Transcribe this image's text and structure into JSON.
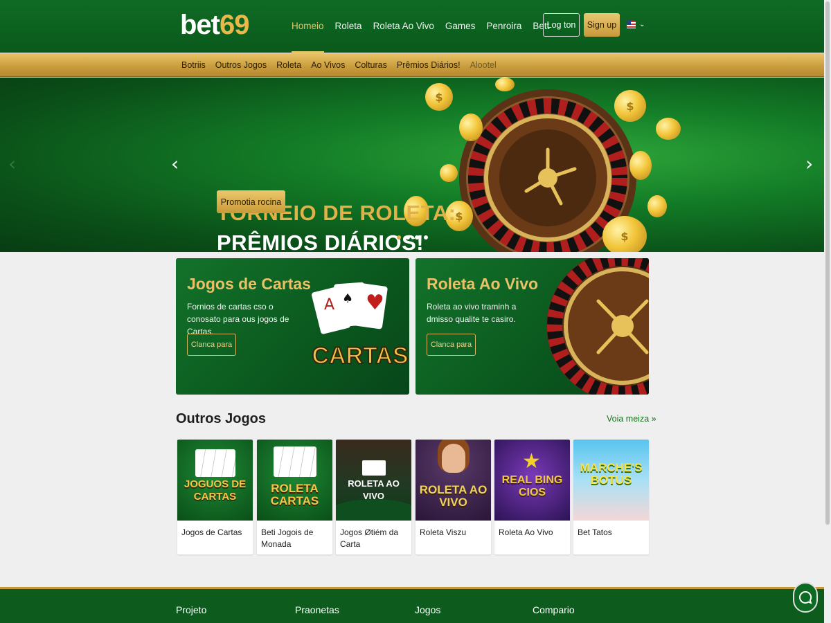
{
  "header": {
    "logo_text": "bet",
    "logo_number": "69",
    "nav": [
      "Homeio",
      "Roleta",
      "Roleta Ao Vivo",
      "Games",
      "Penroira",
      "Bett"
    ],
    "login_label": "Log ton",
    "signup_label": "Sign up",
    "language_icon": "us-flag-icon"
  },
  "subnav": [
    "Botriis",
    "Outros Jogos",
    "Roleta",
    "Ao Vivos",
    "Colturas",
    "Prêmios Diários!",
    "Alootel"
  ],
  "hero": {
    "title_line1": "TORNEIO DE ROLETA:",
    "title_line2": "PRÊMIOS DIÁRIOS!",
    "button_label": "Promotia rocina",
    "slides": 4,
    "active_slide": 1
  },
  "promo_cards": [
    {
      "title": "Jogos de Cartas",
      "text": "Fornios de cartas cso o conosato para ous jogos de Cartas.",
      "button": "Clanca para",
      "art_text": "CARTAS"
    },
    {
      "title": "Roleta Ao Vivo",
      "text": "Roleta ao vivo traminh a dmisso qualite te casiro.",
      "button": "Clanca para"
    }
  ],
  "games_section": {
    "title": "Outros Jogos",
    "see_more": "Voia meiza »",
    "games": [
      {
        "art": "JOGUOS DE CARTAS",
        "name": "Jogos de Cartas"
      },
      {
        "art": "ROLETA CARTAS",
        "name": "Beti Jogois de Monada"
      },
      {
        "art": "ROLETA AO VIVO",
        "name": "Jogos Øtiém da Carta"
      },
      {
        "art": "ROLETA AO VIVO",
        "name": "Roleta Viszu"
      },
      {
        "art": "REAL BING CIOS",
        "name": "Roleta Ao Vivo"
      },
      {
        "art": "MARCHE'S BOTUS",
        "name": "Bet Tatos"
      }
    ]
  },
  "footer": {
    "columns": [
      "Projeto",
      "Praonetas",
      "Jogos",
      "Compario"
    ]
  },
  "colors": {
    "green": "#0f6b24",
    "gold": "#e1b24a",
    "accent": "#c89b3c"
  }
}
